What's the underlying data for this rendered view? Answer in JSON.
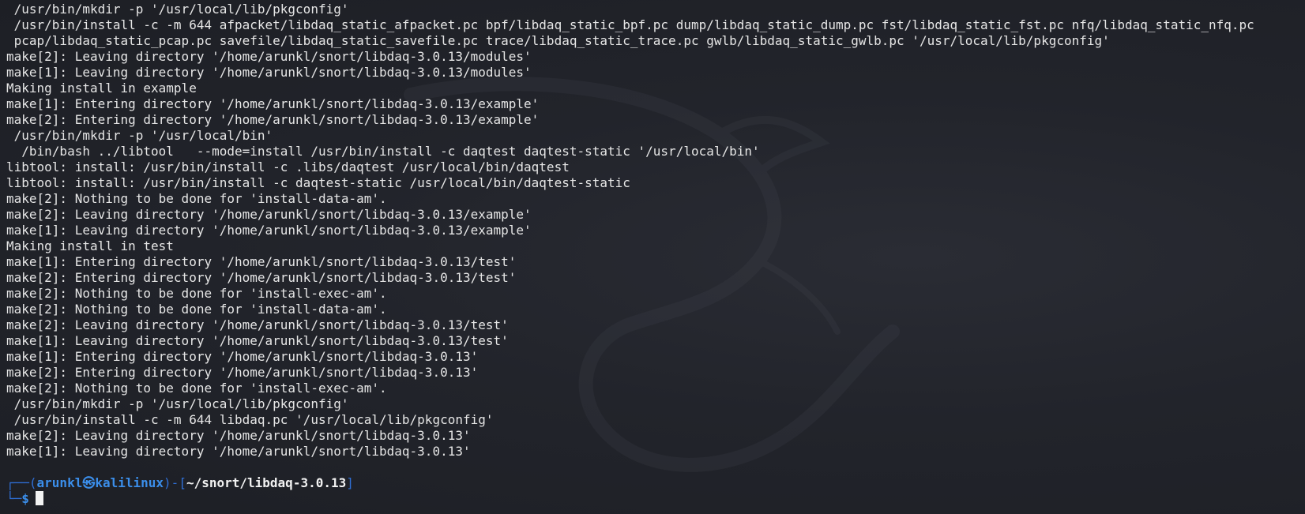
{
  "colors": {
    "background": "#1f2129",
    "text": "#e6e6e6",
    "prompt_accent": "#3b8eea",
    "prompt_frame": "#2f6fd6"
  },
  "output_lines": [
    " /usr/bin/mkdir -p '/usr/local/lib/pkgconfig'",
    " /usr/bin/install -c -m 644 afpacket/libdaq_static_afpacket.pc bpf/libdaq_static_bpf.pc dump/libdaq_static_dump.pc fst/libdaq_static_fst.pc nfq/libdaq_static_nfq.pc",
    " pcap/libdaq_static_pcap.pc savefile/libdaq_static_savefile.pc trace/libdaq_static_trace.pc gwlb/libdaq_static_gwlb.pc '/usr/local/lib/pkgconfig'",
    "make[2]: Leaving directory '/home/arunkl/snort/libdaq-3.0.13/modules'",
    "make[1]: Leaving directory '/home/arunkl/snort/libdaq-3.0.13/modules'",
    "Making install in example",
    "make[1]: Entering directory '/home/arunkl/snort/libdaq-3.0.13/example'",
    "make[2]: Entering directory '/home/arunkl/snort/libdaq-3.0.13/example'",
    " /usr/bin/mkdir -p '/usr/local/bin'",
    "  /bin/bash ../libtool   --mode=install /usr/bin/install -c daqtest daqtest-static '/usr/local/bin'",
    "libtool: install: /usr/bin/install -c .libs/daqtest /usr/local/bin/daqtest",
    "libtool: install: /usr/bin/install -c daqtest-static /usr/local/bin/daqtest-static",
    "make[2]: Nothing to be done for 'install-data-am'.",
    "make[2]: Leaving directory '/home/arunkl/snort/libdaq-3.0.13/example'",
    "make[1]: Leaving directory '/home/arunkl/snort/libdaq-3.0.13/example'",
    "Making install in test",
    "make[1]: Entering directory '/home/arunkl/snort/libdaq-3.0.13/test'",
    "make[2]: Entering directory '/home/arunkl/snort/libdaq-3.0.13/test'",
    "make[2]: Nothing to be done for 'install-exec-am'.",
    "make[2]: Nothing to be done for 'install-data-am'.",
    "make[2]: Leaving directory '/home/arunkl/snort/libdaq-3.0.13/test'",
    "make[1]: Leaving directory '/home/arunkl/snort/libdaq-3.0.13/test'",
    "make[1]: Entering directory '/home/arunkl/snort/libdaq-3.0.13'",
    "make[2]: Entering directory '/home/arunkl/snort/libdaq-3.0.13'",
    "make[2]: Nothing to be done for 'install-exec-am'.",
    " /usr/bin/mkdir -p '/usr/local/lib/pkgconfig'",
    " /usr/bin/install -c -m 644 libdaq.pc '/usr/local/lib/pkgconfig'",
    "make[2]: Leaving directory '/home/arunkl/snort/libdaq-3.0.13'",
    "make[1]: Leaving directory '/home/arunkl/snort/libdaq-3.0.13'",
    ""
  ],
  "prompt": {
    "frame_top": "┌──(",
    "user": "arunkl",
    "skull": "㉿",
    "host": "kalilinux",
    "frame_mid": ")-[",
    "cwd": "~/snort/libdaq-3.0.13",
    "frame_end": "]",
    "frame_bottom": "└─",
    "symbol": "$"
  }
}
